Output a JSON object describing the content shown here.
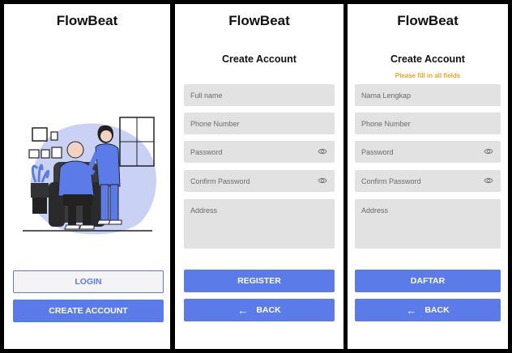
{
  "colors": {
    "primary": "#5b7be8",
    "field_bg": "#e2e2e2",
    "warning": "#e8a324"
  },
  "screen1": {
    "title": "FlowBeat",
    "login_label": "LOGIN",
    "create_label": "CREATE ACCOUNT"
  },
  "screen2": {
    "title": "FlowBeat",
    "heading": "Create Account",
    "fields": {
      "full_name": "Full name",
      "phone": "Phone Number",
      "password": "Password",
      "confirm_password": "Confirm Password",
      "address": "Address"
    },
    "register_label": "REGISTER",
    "back_label": "BACK"
  },
  "screen3": {
    "title": "FlowBeat",
    "heading": "Create Account",
    "error": "Please fill in all fields",
    "fields": {
      "full_name": "Nama Lengkap",
      "phone": "Phone Number",
      "password": "Password",
      "confirm_password": "Confirm Password",
      "address": "Address"
    },
    "submit_label": "DAFTAR",
    "back_label": "BACK"
  },
  "icons": {
    "eye": "eye-icon",
    "back_arrow": "arrow-left-icon"
  }
}
